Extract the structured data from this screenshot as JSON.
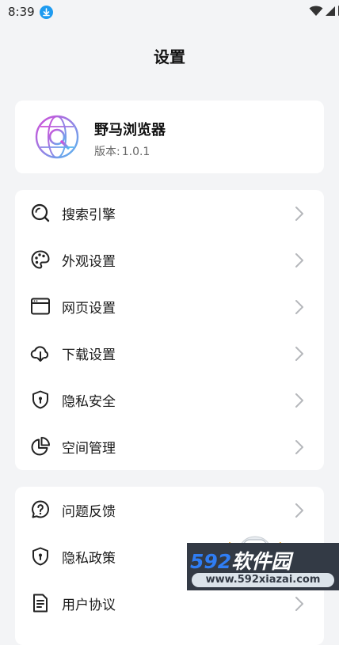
{
  "status_bar": {
    "time": "8:39"
  },
  "page": {
    "title": "设置"
  },
  "app_info": {
    "name": "野马浏览器",
    "version_label": "版本:",
    "version": "1.0.1"
  },
  "menu_group_1": [
    {
      "label": "搜索引擎",
      "icon": "search-icon"
    },
    {
      "label": "外观设置",
      "icon": "palette-icon"
    },
    {
      "label": "网页设置",
      "icon": "browser-window-icon"
    },
    {
      "label": "下载设置",
      "icon": "cloud-download-icon"
    },
    {
      "label": "隐私安全",
      "icon": "shield-lock-icon"
    },
    {
      "label": "空间管理",
      "icon": "pie-chart-icon"
    }
  ],
  "menu_group_2": [
    {
      "label": "问题反馈",
      "icon": "question-icon"
    },
    {
      "label": "隐私政策",
      "icon": "shield-lock-icon"
    },
    {
      "label": "用户协议",
      "icon": "document-icon"
    }
  ],
  "watermark": {
    "title_num": "592",
    "title_text": "软件园",
    "site": "www.592xiazai.com"
  },
  "colors": {
    "background": "#f3f4f6",
    "card": "#ffffff",
    "download_badge": "#1e9bf0",
    "watermark_bg": "#333a45",
    "watermark_accent": "#2f7df4"
  }
}
